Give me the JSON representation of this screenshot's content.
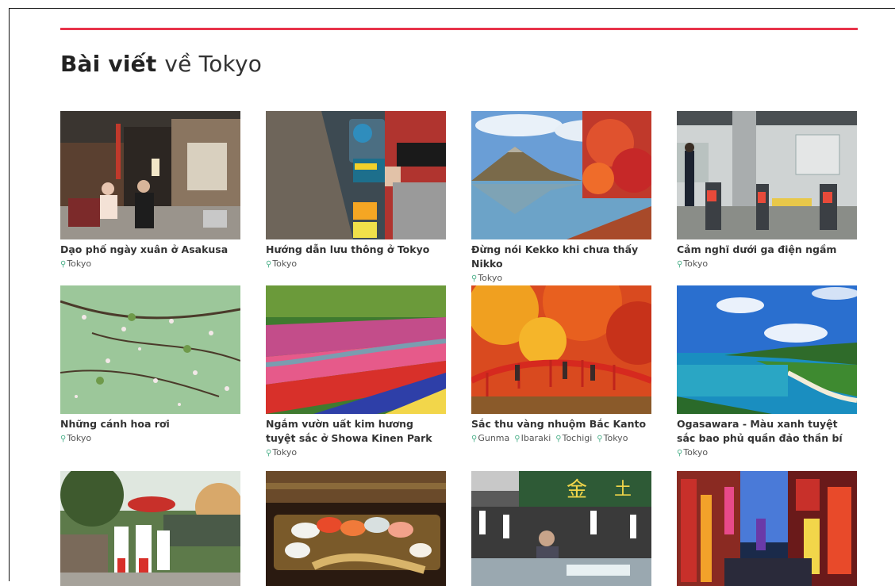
{
  "page": {
    "heading_bold": "Bài viết",
    "heading_rest": "về Tokyo"
  },
  "colors": {
    "accent": "#e8344a",
    "pin": "#4cb08a"
  },
  "articles": [
    {
      "title": "Dạo phố ngày xuân ở Asakusa",
      "tags": [
        "Tokyo"
      ]
    },
    {
      "title": "Hướng dẫn lưu thông ở Tokyo",
      "tags": [
        "Tokyo"
      ]
    },
    {
      "title": "Đừng nói Kekko khi chưa thấy Nikko",
      "tags": [
        "Tokyo"
      ]
    },
    {
      "title": "Cảm nghĩ dưới ga điện ngầm",
      "tags": [
        "Tokyo"
      ]
    },
    {
      "title": "Những cánh hoa rơi",
      "tags": [
        "Tokyo"
      ]
    },
    {
      "title": "Ngắm vườn uất kim hương tuyệt sắc ở Showa Kinen Park",
      "tags": [
        "Tokyo"
      ]
    },
    {
      "title": "Sắc thu vàng nhuộm Bắc Kanto",
      "tags": [
        "Gunma",
        "Ibaraki",
        "Tochigi",
        "Tokyo"
      ]
    },
    {
      "title": "Ogasawara - Màu xanh tuyệt sắc bao phủ quần đảo thần bí",
      "tags": [
        "Tokyo"
      ]
    },
    {
      "title": "",
      "tags": []
    },
    {
      "title": "",
      "tags": []
    },
    {
      "title": "",
      "tags": []
    },
    {
      "title": "",
      "tags": []
    }
  ]
}
